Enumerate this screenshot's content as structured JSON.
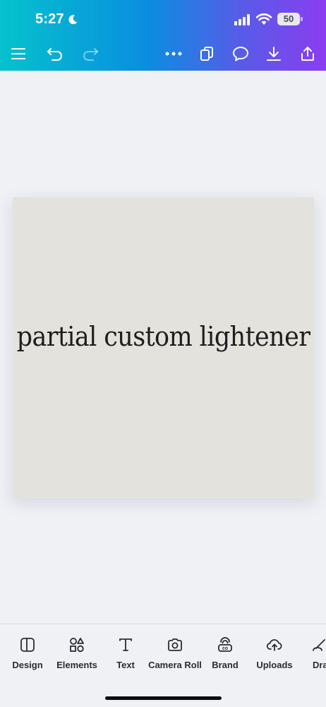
{
  "status_bar": {
    "time": "5:27",
    "battery": "50",
    "icons": [
      "moon-icon",
      "signal-icon",
      "wifi-icon",
      "battery-icon"
    ]
  },
  "toolbar": {
    "icons": [
      "menu-icon",
      "undo-icon",
      "redo-icon",
      "more-icon",
      "pages-icon",
      "comment-icon",
      "download-icon",
      "share-icon"
    ]
  },
  "canvas": {
    "text": "partial custom lightener",
    "background": "#e4e2dc"
  },
  "bottom_nav": {
    "items": [
      {
        "label": "Design",
        "icon": "design-icon"
      },
      {
        "label": "Elements",
        "icon": "elements-icon"
      },
      {
        "label": "Text",
        "icon": "text-icon"
      },
      {
        "label": "Camera Roll",
        "icon": "camera-icon"
      },
      {
        "label": "Brand",
        "icon": "brand-icon"
      },
      {
        "label": "Uploads",
        "icon": "uploads-icon"
      },
      {
        "label": "Dra",
        "icon": "draw-icon"
      }
    ]
  },
  "colors": {
    "header_gradient_start": "#05c2cc",
    "header_gradient_end": "#8a3df0",
    "page_background": "#f0f1f5"
  }
}
